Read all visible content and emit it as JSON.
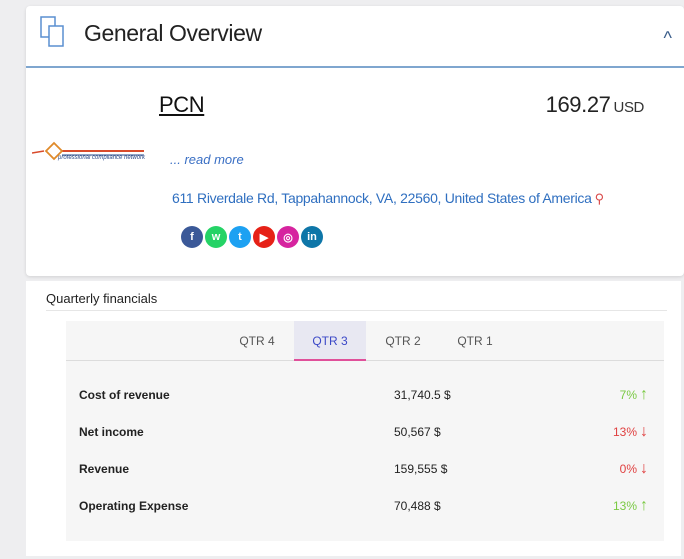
{
  "overview": {
    "title": "General Overview",
    "company_name": "PCN",
    "logo_text": "professional compliance network",
    "price_value": "169.27",
    "price_currency": "USD",
    "read_more": "... read more",
    "address": "611 Riverdale Rd, Tappahannock, VA, 22560, United States of America",
    "socials": [
      {
        "label": "f",
        "color": "#3b5998"
      },
      {
        "label": "w",
        "color": "#25d366"
      },
      {
        "label": "t",
        "color": "#1da1f2"
      },
      {
        "label": "▶",
        "color": "#e62117"
      },
      {
        "label": "◎",
        "color": "#d6249f"
      },
      {
        "label": "in",
        "color": "#0e76a8"
      }
    ]
  },
  "financials": {
    "title": "Quarterly financials",
    "tabs": [
      "QTR 4",
      "QTR 3",
      "QTR 2",
      "QTR 1"
    ],
    "active_tab": "QTR 3",
    "rows": [
      {
        "label": "Cost of revenue",
        "value": "31,740.5 $",
        "percent": "7%",
        "trend": "up"
      },
      {
        "label": "Net income",
        "value": "50,567 $",
        "percent": "13%",
        "trend": "down"
      },
      {
        "label": "Revenue",
        "value": "159,555 $",
        "percent": "0%",
        "trend": "down"
      },
      {
        "label": "Operating Expense",
        "value": "70,488 $",
        "percent": "13%",
        "trend": "up"
      }
    ]
  },
  "colors": {
    "up": "#7ac943",
    "down": "#e04141",
    "link": "#2f6fc0",
    "accent": "#3b48c7"
  }
}
